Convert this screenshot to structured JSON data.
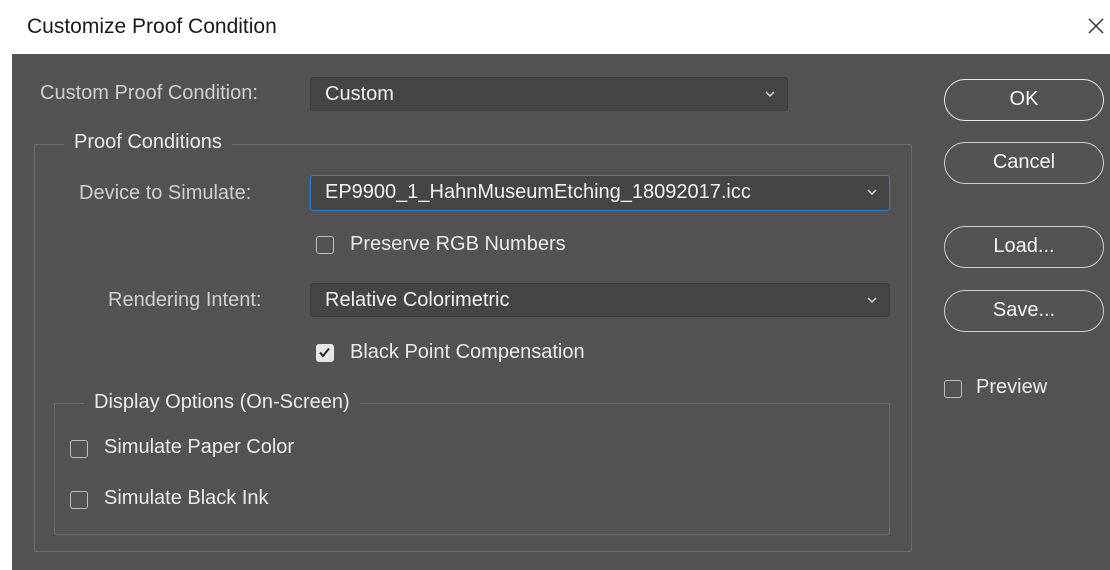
{
  "dialog": {
    "title": "Customize Proof Condition",
    "close_icon": "close-icon"
  },
  "custom_condition": {
    "label": "Custom Proof Condition:",
    "value": "Custom"
  },
  "proof_conditions": {
    "group_title": "Proof Conditions",
    "device_label": "Device to Simulate:",
    "device_value": "EP9900_1_HahnMuseumEtching_18092017.icc",
    "preserve_rgb_label": "Preserve RGB Numbers",
    "preserve_rgb_checked": false,
    "rendering_label": "Rendering Intent:",
    "rendering_value": "Relative Colorimetric",
    "bpc_label": "Black Point Compensation",
    "bpc_checked": true
  },
  "display_options": {
    "group_title": "Display Options (On-Screen)",
    "paper_color_label": "Simulate Paper Color",
    "paper_color_checked": false,
    "black_ink_label": "Simulate Black Ink",
    "black_ink_checked": false
  },
  "buttons": {
    "ok": "OK",
    "cancel": "Cancel",
    "load": "Load...",
    "save": "Save..."
  },
  "preview": {
    "label": "Preview",
    "checked": false
  },
  "colors": {
    "panel_bg": "#535353",
    "field_bg": "#454545",
    "focus_accent": "#2d7ddf"
  }
}
